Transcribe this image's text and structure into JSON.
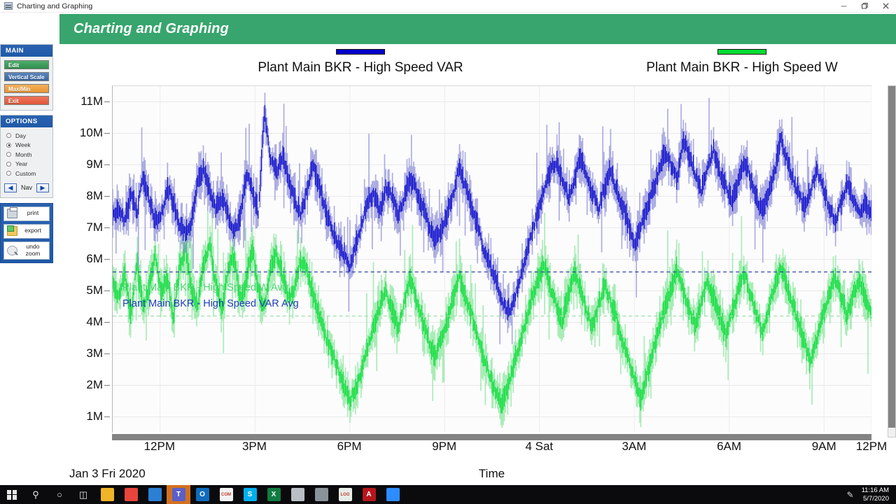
{
  "window": {
    "title": "Charting and Graphing",
    "icon": "app-chart-icon",
    "minimize_label": "—",
    "restore_label": "❐",
    "close_label": "✕"
  },
  "header": {
    "title": "Charting and Graphing",
    "bg_color": "#37a56d",
    "text_color": "#ffffff"
  },
  "sidebar": {
    "main": {
      "title": "MAIN",
      "buttons": [
        {
          "label": "Edit",
          "color": "#3f9e5b"
        },
        {
          "label": "Vertical Scale",
          "color": "#4a79b2"
        },
        {
          "label": "Max/Min",
          "color": "#efa344"
        },
        {
          "label": "Exit",
          "color": "#e86649"
        }
      ]
    },
    "options": {
      "title": "OPTIONS",
      "radios": [
        {
          "label": "Day",
          "selected": false
        },
        {
          "label": "Week",
          "selected": true
        },
        {
          "label": "Month",
          "selected": false
        },
        {
          "label": "Year",
          "selected": false
        },
        {
          "label": "Custom",
          "selected": false
        }
      ],
      "nav": {
        "label": "Nav",
        "prev_icon": "left-arrow-icon",
        "next_icon": "right-arrow-icon"
      }
    },
    "tools": [
      {
        "label": "print",
        "icon": "printer-icon"
      },
      {
        "label": "export",
        "icon": "export-folder-icon"
      },
      {
        "label": "undo\nzoom",
        "label_line1": "undo",
        "label_line2": "zoom",
        "icon": "magnifier-undo-icon"
      }
    ]
  },
  "chart_data": {
    "type": "line",
    "title": "",
    "xlabel": "Time",
    "ylabel": "",
    "x_start_label": "Jan 3 Fri 2020",
    "grid": true,
    "legend_position": "top",
    "legend": [
      {
        "name": "Plant Main BKR - High Speed VAR",
        "color": "#0000cc"
      },
      {
        "name": "Plant Main BKR - High Speed W",
        "color": "#00dd33"
      }
    ],
    "annotations": [
      {
        "text": "Plant Main BKR - High Speed W Avg",
        "color": "#45d96a",
        "value": 5600000
      },
      {
        "text": "Plant Main BKR - High Speed VAR Avg",
        "color": "#1f3fb5",
        "value": 5250000
      }
    ],
    "reference_lines": [
      {
        "label": "Plant Main BKR - High Speed VAR Avg",
        "value": 5600000,
        "color": "#3344aa",
        "style": "dashed"
      },
      {
        "label": "Plant Main BKR - High Speed W Avg",
        "value": 4200000,
        "color": "#9fe0a8",
        "style": "dashed"
      }
    ],
    "ylim": [
      500000,
      11500000
    ],
    "yticks": [
      1000000,
      2000000,
      3000000,
      4000000,
      5000000,
      6000000,
      7000000,
      8000000,
      9000000,
      10000000,
      11000000
    ],
    "ytick_labels": [
      "1M",
      "2M",
      "3M",
      "4M",
      "5M",
      "6M",
      "7M",
      "8M",
      "9M",
      "10M",
      "11M"
    ],
    "xticks": [
      0.0625,
      0.1875,
      0.3125,
      0.4375,
      0.5625,
      0.6875,
      0.8125,
      0.9375,
      1.0
    ],
    "xtick_labels": [
      "12PM",
      "3PM",
      "6PM",
      "9PM",
      "4 Sat",
      "3AM",
      "6AM",
      "9AM",
      "12PM"
    ],
    "series": [
      {
        "name": "Plant Main BKR - High Speed VAR",
        "color": "#0000cc",
        "band_color": "#8f8fd8",
        "baseline": 7000000,
        "values": [
          7.3,
          7.6,
          7.2,
          8.1,
          7.5,
          8.6,
          7.9,
          7.2,
          7.4,
          8.3,
          7.8,
          7.1,
          6.8,
          7.2,
          8.4,
          8.9,
          8.2,
          7.6,
          8.0,
          7.4,
          6.9,
          7.3,
          8.7,
          8.2,
          7.5,
          10.7,
          9.2,
          8.8,
          9.3,
          8.5,
          7.9,
          7.4,
          8.2,
          9.0,
          8.3,
          7.6,
          7.0,
          6.5,
          6.2,
          5.8,
          6.4,
          7.1,
          7.8,
          8.1,
          7.5,
          8.3,
          8.0,
          7.4,
          7.9,
          8.6,
          8.2,
          7.7,
          7.1,
          6.6,
          6.9,
          7.4,
          8.0,
          8.9,
          8.4,
          7.8,
          7.2,
          6.4,
          5.9,
          5.4,
          4.8,
          4.3,
          4.6,
          5.2,
          6.1,
          6.8,
          7.5,
          8.2,
          8.8,
          9.1,
          8.6,
          8.0,
          8.4,
          9.3,
          8.7,
          8.1,
          7.6,
          8.3,
          8.9,
          8.2,
          7.7,
          7.1,
          6.5,
          7.0,
          7.6,
          8.2,
          8.8,
          9.4,
          9.0,
          8.5,
          9.8,
          9.3,
          8.7,
          8.2,
          8.9,
          9.5,
          8.8,
          8.3,
          7.8,
          8.4,
          9.1,
          8.6,
          8.0,
          7.5,
          8.1,
          8.7,
          9.9,
          9.2,
          8.6,
          8.1,
          7.6,
          8.2,
          8.8,
          8.3,
          7.7,
          7.2,
          7.8,
          8.4,
          7.9,
          7.4,
          7.8,
          7.5
        ]
      },
      {
        "name": "Plant Main BKR - High Speed W",
        "color": "#00dd33",
        "band_color": "#8ae79b",
        "baseline": 4600000,
        "values": [
          5.2,
          4.8,
          5.6,
          4.2,
          5.9,
          4.5,
          5.1,
          6.2,
          4.9,
          5.4,
          4.1,
          5.8,
          6.3,
          5.0,
          4.6,
          5.9,
          6.5,
          5.2,
          4.3,
          5.7,
          6.1,
          4.8,
          5.3,
          6.4,
          5.0,
          4.4,
          5.8,
          6.2,
          5.5,
          4.7,
          5.1,
          6.0,
          5.6,
          4.9,
          4.2,
          3.6,
          3.1,
          2.6,
          2.0,
          1.5,
          1.9,
          2.5,
          3.2,
          3.9,
          4.5,
          5.0,
          4.4,
          3.8,
          4.6,
          5.4,
          4.8,
          4.1,
          3.5,
          2.9,
          3.4,
          4.0,
          4.7,
          5.5,
          4.9,
          4.3,
          3.7,
          3.0,
          2.4,
          1.8,
          1.4,
          1.9,
          2.6,
          3.3,
          4.0,
          4.7,
          5.3,
          5.9,
          5.2,
          4.6,
          4.0,
          4.8,
          5.6,
          5.0,
          4.4,
          3.8,
          4.5,
          5.2,
          4.7,
          4.1,
          3.4,
          2.8,
          2.2,
          1.6,
          2.3,
          3.0,
          3.8,
          4.5,
          5.1,
          5.7,
          5.0,
          4.4,
          3.9,
          4.6,
          5.3,
          4.8,
          4.2,
          3.6,
          4.3,
          5.0,
          5.6,
          4.9,
          4.3,
          3.7,
          4.4,
          5.1,
          5.8,
          5.2,
          4.6,
          4.0,
          3.3,
          2.7,
          3.5,
          4.2,
          4.9,
          5.5,
          4.8,
          4.2,
          4.9,
          5.4,
          4.7,
          4.3
        ]
      }
    ]
  },
  "scrollbars": {
    "vertical": "vertical-scrollbar",
    "horizontal": "horizontal-scrollbar"
  },
  "taskbar": {
    "start_label": "start-button",
    "search_label": "⌕",
    "cortana_label": "○",
    "taskview_label": "▥",
    "apps": [
      {
        "name": "file-explorer",
        "color": "#f0b429",
        "letter": ""
      },
      {
        "name": "google-chrome",
        "color": "#e8453c",
        "letter": ""
      },
      {
        "name": "edge-browser",
        "color": "#2b7fd4",
        "letter": ""
      },
      {
        "name": "microsoft-teams",
        "color": "#5b5fc7",
        "letter": "T",
        "active": true
      },
      {
        "name": "outlook",
        "color": "#0f6cbd",
        "letter": "O"
      },
      {
        "name": "com-pdf",
        "color": "#f2f2f2",
        "letter": "COM"
      },
      {
        "name": "skype",
        "color": "#00aff0",
        "letter": "S"
      },
      {
        "name": "excel",
        "color": "#107c41",
        "letter": "X"
      },
      {
        "name": "remote-desktop",
        "color": "#b9bfc5",
        "letter": ""
      },
      {
        "name": "screen-app",
        "color": "#8a929a",
        "letter": ""
      },
      {
        "name": "log-app",
        "color": "#e8ece8",
        "letter": "LOG"
      },
      {
        "name": "adobe-reader",
        "color": "#b5161c",
        "letter": "A"
      },
      {
        "name": "zoom-app",
        "color": "#2d8cff",
        "letter": ""
      }
    ],
    "tray": {
      "pen_icon": "pen-icon",
      "time": "11:16 AM",
      "date": "5/7/2020"
    }
  }
}
